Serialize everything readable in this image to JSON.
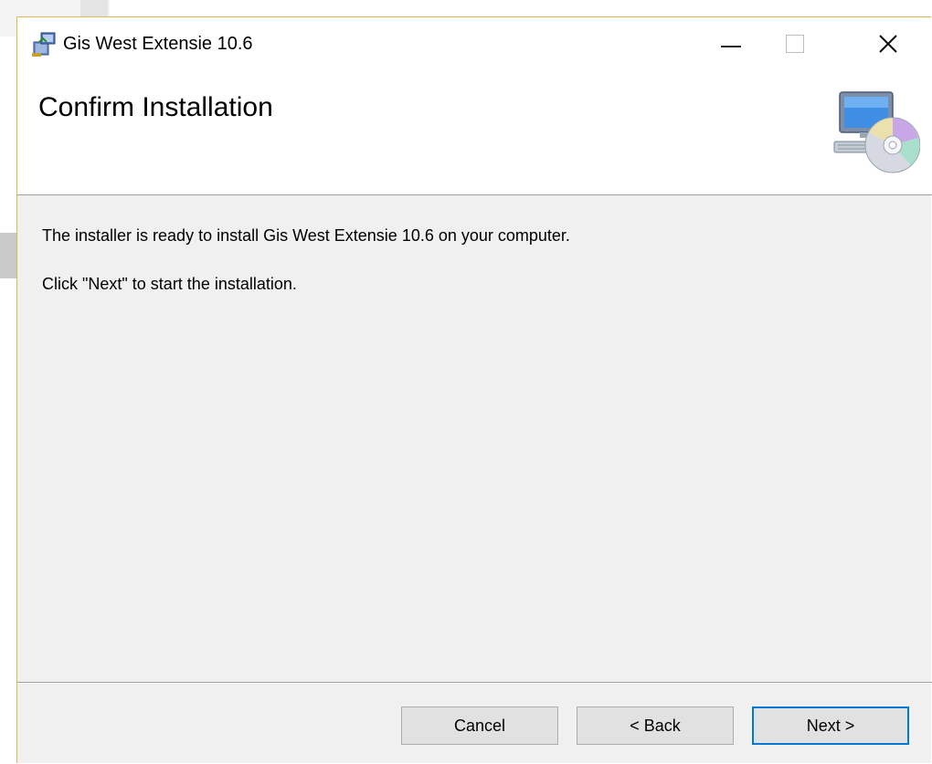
{
  "window": {
    "title": "Gis West Extensie 10.6",
    "icon": "installer-package-icon",
    "controls": {
      "minimize_icon": "minimize-icon",
      "maximize_icon": "maximize-icon",
      "close_icon": "close-icon",
      "close_glyph": "✕"
    }
  },
  "header": {
    "title": "Confirm Installation",
    "icon": "computer-cd-icon"
  },
  "body": {
    "line1": "The installer is ready to install Gis West Extensie 10.6 on your computer.",
    "line2": "Click \"Next\" to start the installation."
  },
  "buttons": {
    "cancel": "Cancel",
    "back": "< Back",
    "next": "Next >"
  },
  "colors": {
    "window_border": "#e1b84a",
    "next_focus": "#0078d7",
    "dialog_bg": "#f0f0f0"
  }
}
